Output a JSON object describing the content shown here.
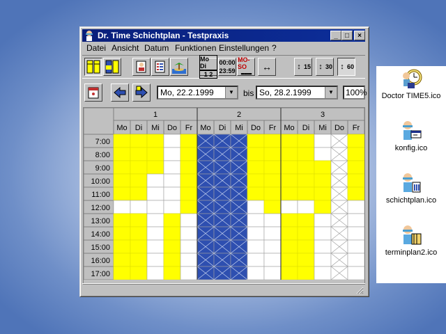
{
  "window": {
    "title": "Dr. Time Schichtplan - Testpraxis",
    "buttons": {
      "minimize": "_",
      "maximize": "□",
      "close": "×"
    }
  },
  "menu": [
    "Datei",
    "Ansicht",
    "Datum",
    "Funktionen",
    "Einstellungen",
    "?"
  ],
  "toolbar": {
    "md_top": "Mo Di",
    "md_bottom": "1 2",
    "time_top": "00:00",
    "time_bottom": "23:59",
    "mo_so": "MO-SO",
    "z15": "15",
    "z30": "30",
    "z60": "60"
  },
  "nav": {
    "from_date": "Mo, 22.2.1999",
    "bis_label": "bis",
    "to_date": "So, 28.2.1999",
    "zoom": "100%"
  },
  "schedule": {
    "weeks": [
      "1",
      "2",
      "3"
    ],
    "days": [
      "Mo",
      "Di",
      "Mi",
      "Do",
      "Fr",
      "Mo",
      "Di",
      "Mi",
      "Do",
      "Fr",
      "Mo",
      "Di",
      "Mi",
      "Do",
      "Fr"
    ],
    "times": [
      "7:00",
      "8:00",
      "9:00",
      "10:00",
      "11:00",
      "12:00",
      "13:00",
      "14:00",
      "15:00",
      "16:00",
      "17:00"
    ],
    "colors": {
      "yellow": "#ffff00",
      "blue": "#2e4fb0",
      "white": "#ffffff"
    },
    "columns": [
      [
        "y",
        "y",
        "y",
        "y",
        "y",
        "w",
        "y",
        "y",
        "y",
        "y",
        "y"
      ],
      [
        "y",
        "y",
        "y",
        "y",
        "y",
        "w",
        "y",
        "y",
        "y",
        "y",
        "y"
      ],
      [
        "y",
        "y",
        "y",
        "w",
        "w",
        "w",
        "w",
        "w",
        "w",
        "w",
        "w"
      ],
      [
        "w",
        "w",
        "w",
        "w",
        "w",
        "w",
        "y",
        "y",
        "y",
        "y",
        "y"
      ],
      [
        "y",
        "y",
        "y",
        "y",
        "y",
        "y",
        "w",
        "w",
        "w",
        "w",
        "w"
      ],
      [
        "b",
        "b",
        "b",
        "b",
        "b",
        "b",
        "b",
        "b",
        "b",
        "b",
        "b"
      ],
      [
        "b",
        "b",
        "b",
        "b",
        "b",
        "b",
        "b",
        "b",
        "b",
        "b",
        "b"
      ],
      [
        "b",
        "b",
        "b",
        "b",
        "b",
        "b",
        "b",
        "b",
        "b",
        "b",
        "b"
      ],
      [
        "y",
        "y",
        "y",
        "y",
        "y",
        "w",
        "w",
        "w",
        "w",
        "w",
        "w"
      ],
      [
        "y",
        "y",
        "y",
        "y",
        "y",
        "y",
        "w",
        "w",
        "w",
        "w",
        "w"
      ],
      [
        "y",
        "y",
        "y",
        "y",
        "y",
        "w",
        "y",
        "y",
        "y",
        "y",
        "y"
      ],
      [
        "y",
        "y",
        "y",
        "y",
        "y",
        "w",
        "y",
        "y",
        "y",
        "y",
        "y"
      ],
      [
        "w",
        "w",
        "y",
        "y",
        "y",
        "y",
        "w",
        "w",
        "w",
        "w",
        "w"
      ],
      [
        "x",
        "x",
        "x",
        "x",
        "x",
        "x",
        "x",
        "x",
        "x",
        "x",
        "x"
      ],
      [
        "y",
        "y",
        "y",
        "y",
        "y",
        "w",
        "w",
        "w",
        "w",
        "w",
        "w"
      ]
    ]
  },
  "desktop": [
    {
      "label": "Doctor TIME5.ico",
      "icon": "clock-doctor-icon"
    },
    {
      "label": "konfig.ico",
      "icon": "doctor-config-icon"
    },
    {
      "label": "schichtplan.ico",
      "icon": "doctor-schedule-icon"
    },
    {
      "label": "terminplan2.ico",
      "icon": "doctor-calendar-icon"
    }
  ]
}
